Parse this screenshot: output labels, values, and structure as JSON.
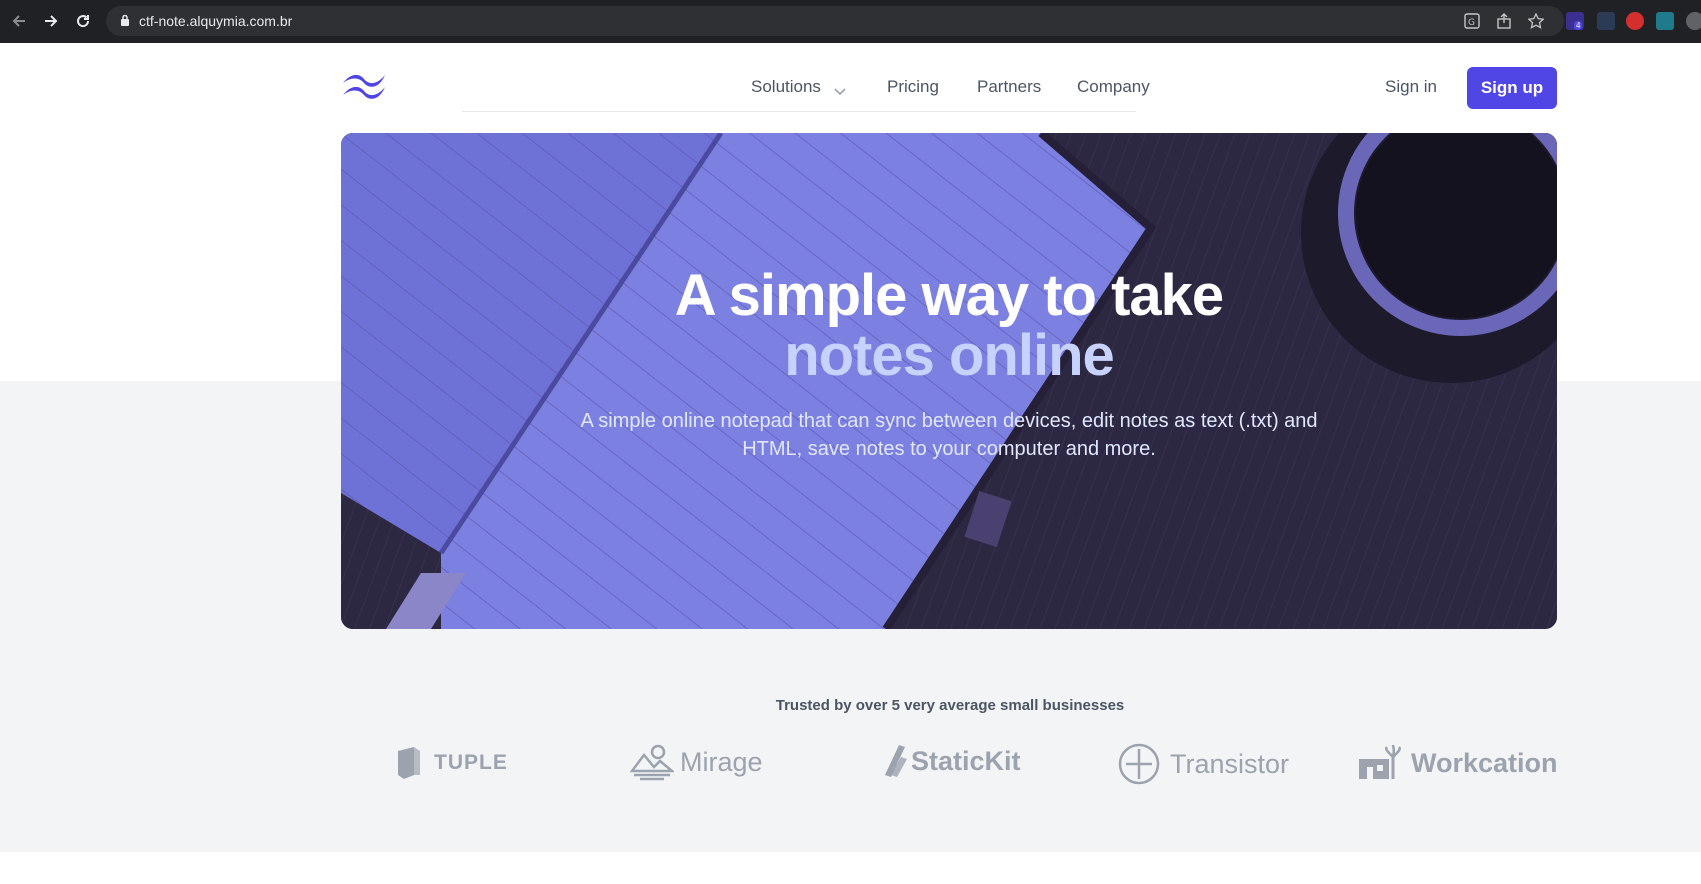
{
  "browser": {
    "url": "ctf-note.alquymia.com.br",
    "extension_badge": "4"
  },
  "nav": {
    "links": [
      "Solutions",
      "Pricing",
      "Partners",
      "Company"
    ],
    "sign_in": "Sign in",
    "sign_up": "Sign up"
  },
  "hero": {
    "title_line1": "A simple way to take",
    "title_line2": "notes online",
    "subtitle_line1": "A simple online notepad that can sync between devices, edit notes as text (.txt) and",
    "subtitle_line2": "HTML, save notes to your computer and more."
  },
  "trusted": {
    "heading": "Trusted by over 5 very average small businesses",
    "logos": [
      "TUPLE",
      "Mirage",
      "StaticKit",
      "Transistor",
      "Workcation"
    ]
  },
  "colors": {
    "accent": "#4f46e5",
    "hero_highlight": "#c7d2fe"
  }
}
